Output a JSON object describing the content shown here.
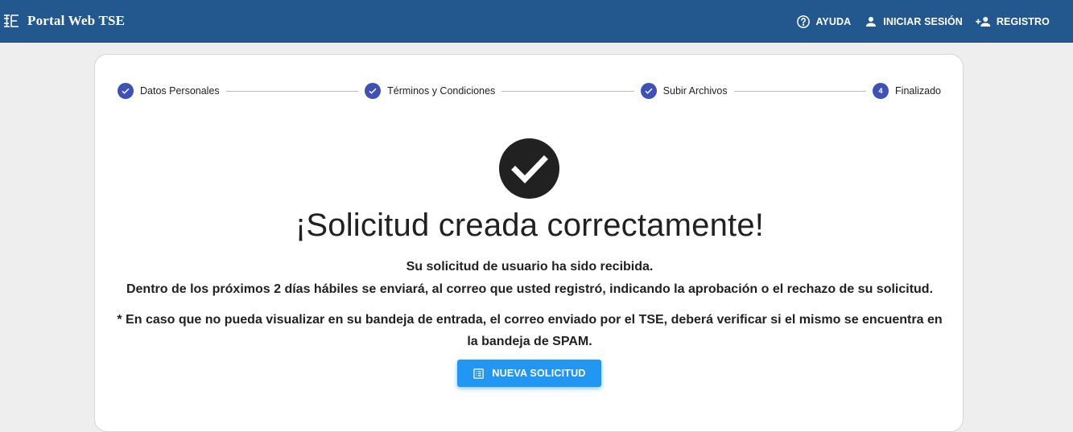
{
  "header": {
    "title": "Portal Web TSE",
    "logo_icon": "tse-logo-icon",
    "nav": [
      {
        "label": "AYUDA",
        "icon": "help-circle-icon"
      },
      {
        "label": "INICIAR SESIÓN",
        "icon": "person-icon"
      },
      {
        "label": "REGISTRO",
        "icon": "person-add-icon"
      }
    ]
  },
  "stepper": {
    "steps": [
      {
        "label": "Datos Personales",
        "state": "completed"
      },
      {
        "label": "Términos y Condiciones",
        "state": "completed"
      },
      {
        "label": "Subir Archivos",
        "state": "completed"
      },
      {
        "label": "Finalizado",
        "state": "active",
        "number": "4"
      }
    ]
  },
  "main": {
    "headline": "¡Solicitud creada correctamente!",
    "line1": "Su solicitud de usuario ha sido recibida.",
    "line2": "Dentro de los próximos 2 días hábiles se enviará, al correo que usted registró, indicando la aprobación o el rechazo de su solicitud.",
    "line3": "* En caso que no pueda visualizar en su bandeja de entrada, el correo enviado por el TSE, deberá verificar si el mismo se encuentra en la bandeja de SPAM.",
    "button_label": "NUEVA SOLICITUD"
  },
  "colors": {
    "header_bg": "#23588f",
    "step_active": "#3f51b5",
    "button_bg": "#2196f3",
    "success_icon": "#212121"
  }
}
